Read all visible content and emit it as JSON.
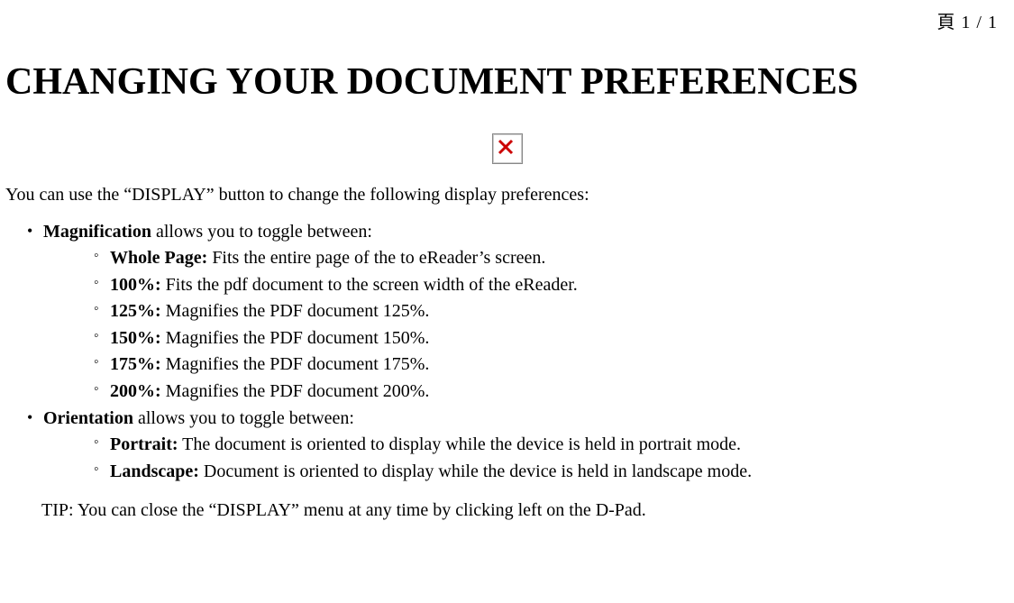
{
  "page_indicator": "頁 1 / 1",
  "title": "CHANGING YOUR DOCUMENT PREFERENCES",
  "broken_image_alt": "broken-image-icon",
  "intro": "You can use the “DISPLAY” button to change the following display preferences:",
  "sections": [
    {
      "label": "Magnification",
      "rest": " allows you to toggle between:",
      "items": [
        {
          "label": "Whole Page:",
          "rest": " Fits the entire page of the to eReader’s screen."
        },
        {
          "label": "100%:",
          "rest": " Fits the pdf document to the screen width of the eReader."
        },
        {
          "label": "125%:",
          "rest": " Magnifies the PDF document 125%."
        },
        {
          "label": "150%:",
          "rest": " Magnifies the PDF document 150%."
        },
        {
          "label": "175%:",
          "rest": " Magnifies the PDF document 175%."
        },
        {
          "label": "200%:",
          "rest": " Magnifies the PDF document 200%."
        }
      ]
    },
    {
      "label": "Orientation",
      "rest": " allows you to toggle between:",
      "items": [
        {
          "label": "Portrait:",
          "rest": " The document is oriented to display while the device is held in portrait mode."
        },
        {
          "label": "Landscape:",
          "rest": " Document is oriented to display while the device is held in landscape mode."
        }
      ]
    }
  ],
  "tip": "TIP: You can close the “DISPLAY” menu at any time by clicking left on the D-Pad."
}
